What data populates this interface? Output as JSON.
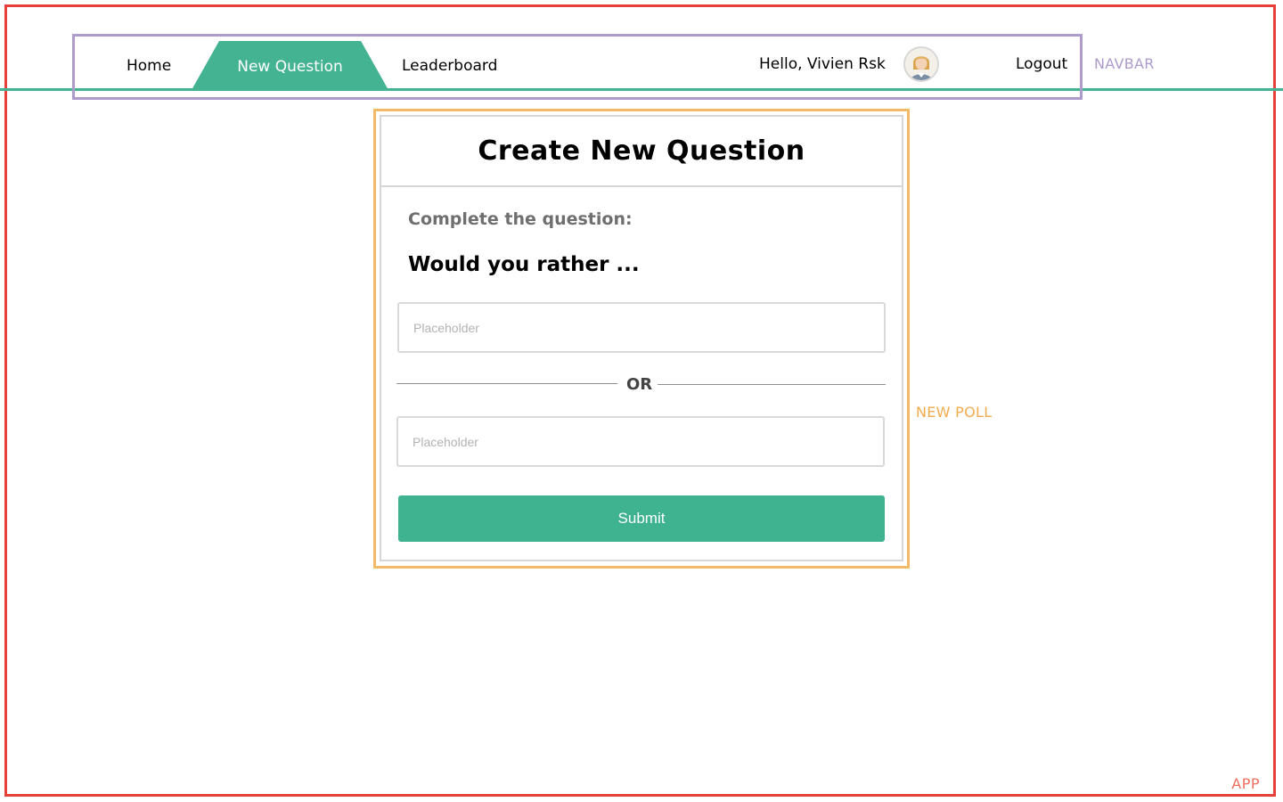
{
  "annotations": {
    "app": "APP",
    "navbar": "NAVBAR",
    "new_poll": "NEW POLL"
  },
  "nav": {
    "home": "Home",
    "new_question": "New Question",
    "leaderboard": "Leaderboard",
    "greeting": "Hello, Vivien Rsk",
    "logout": "Logout",
    "avatar_icon": "user-avatar-icon",
    "active_tab": "New Question"
  },
  "form": {
    "title": "Create New Question",
    "subtitle": "Complete the question:",
    "prompt": "Would you rather ...",
    "option_one": {
      "placeholder": "Placeholder",
      "value": ""
    },
    "separator": "OR",
    "option_two": {
      "placeholder": "Placeholder",
      "value": ""
    },
    "submit_label": "Submit"
  },
  "colors": {
    "accent": "#44b391",
    "app_annotation": "#e5413a",
    "navbar_annotation": "#ad9bcc",
    "poll_annotation": "#f2b967"
  }
}
